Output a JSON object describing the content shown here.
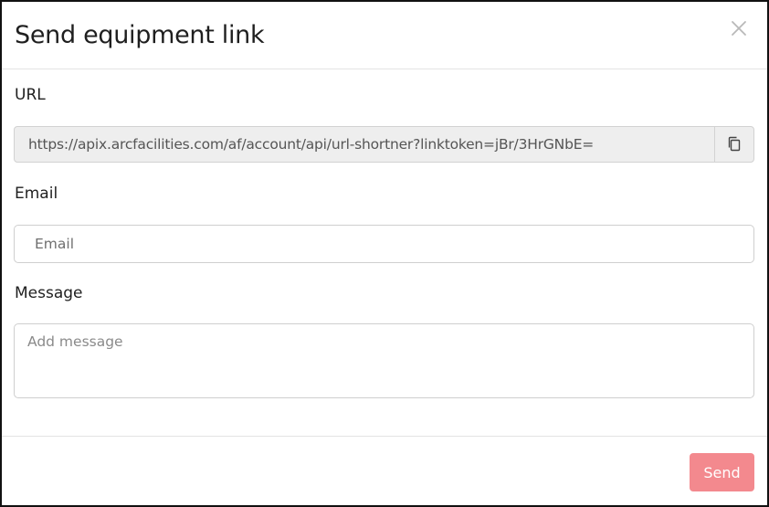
{
  "dialog": {
    "title": "Send equipment link",
    "close_icon": "close-icon"
  },
  "url_field": {
    "label": "URL",
    "value": "https://apix.arcfacilities.com/af/account/api/url-shortner?linktoken=jBr/3HrGNbE=",
    "copy_icon": "copy-icon"
  },
  "email_field": {
    "label": "Email",
    "value": "",
    "placeholder": "Email"
  },
  "message_field": {
    "label": "Message",
    "value": "",
    "placeholder": "Add message"
  },
  "footer": {
    "send_label": "Send"
  },
  "colors": {
    "send_button": "#f3898e",
    "readonly_background": "#eeeeee",
    "frame_border": "#111111"
  }
}
